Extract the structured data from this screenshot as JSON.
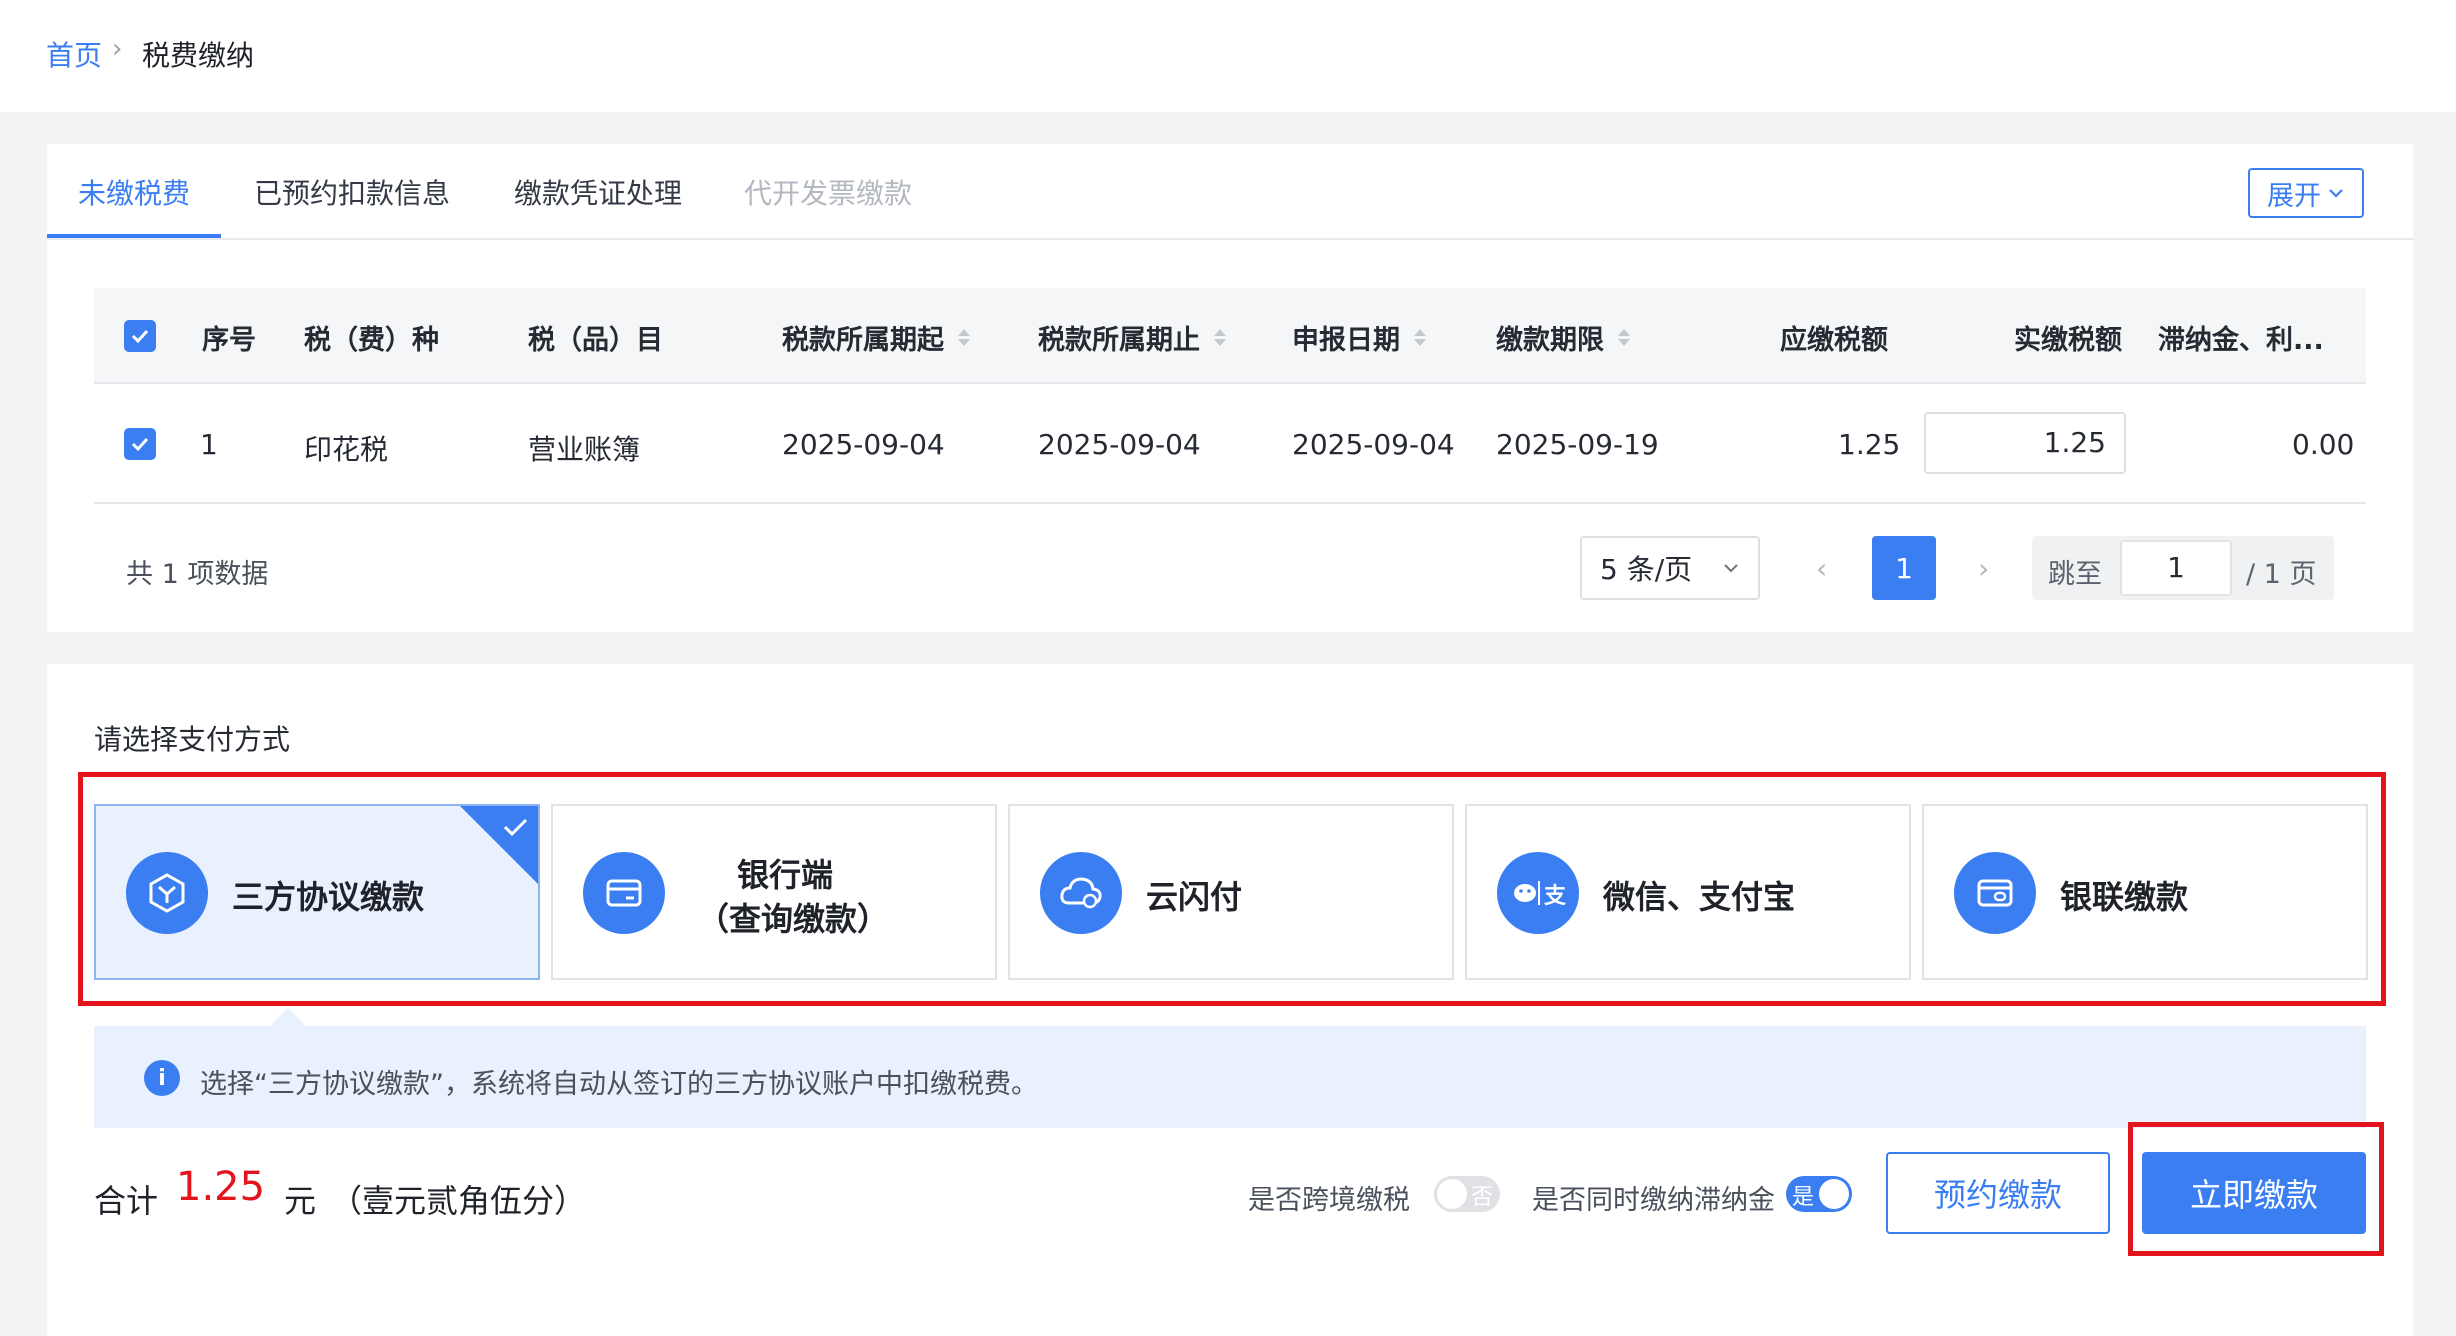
{
  "breadcrumb": {
    "home": "首页",
    "separator": "›",
    "current": "税费缴纳"
  },
  "tabs": [
    {
      "label": "未缴税费",
      "state": "active"
    },
    {
      "label": "已预约扣款信息",
      "state": "normal"
    },
    {
      "label": "缴款凭证处理",
      "state": "normal"
    },
    {
      "label": "代开发票缴款",
      "state": "disabled"
    }
  ],
  "expand_button": {
    "label": "展开",
    "icon": "chevron-down-icon"
  },
  "table": {
    "headers": {
      "seq": "序号",
      "tax_type": "税（费）种",
      "tax_item": "税（品）目",
      "period_start": "税款所属期起",
      "period_end": "税款所属期止",
      "declare_date": "申报日期",
      "pay_deadline": "缴款期限",
      "payable": "应缴税额",
      "actual": "实缴税额",
      "late_fee": "滞纳金、利..."
    },
    "rows": [
      {
        "seq": "1",
        "tax_type": "印花税",
        "tax_item": "营业账簿",
        "period_start": "2025-09-04",
        "period_end": "2025-09-04",
        "declare_date": "2025-09-04",
        "pay_deadline": "2025-09-19",
        "payable": "1.25",
        "actual": "1.25",
        "late_fee": "0.00",
        "checked": true
      }
    ]
  },
  "pagination": {
    "total_text": "共 1 项数据",
    "page_size": "5 条/页",
    "prev": "‹",
    "next": "›",
    "current_page": "1",
    "jump_label": "跳至",
    "jump_value": "1",
    "total_pages_text": "/ 1 页"
  },
  "payment": {
    "title": "请选择支付方式",
    "options": [
      {
        "label": "三方协议缴款",
        "icon": "hexagon-icon",
        "selected": true
      },
      {
        "label_line1": "银行端",
        "label_line2": "（查询缴款）",
        "icon": "card-icon",
        "selected": false
      },
      {
        "label": "云闪付",
        "icon": "cloud-icon",
        "selected": false
      },
      {
        "label": "微信、支付宝",
        "icon": "wechat-alipay-icon",
        "selected": false
      },
      {
        "label": "银联缴款",
        "icon": "unionpay-icon",
        "selected": false
      }
    ],
    "info_text": "选择“三方协议缴款”，系统将自动从签订的三方协议账户中扣缴税费。"
  },
  "summary": {
    "label": "合计",
    "amount": "1.25",
    "unit": "元",
    "amount_cn": "（壹元贰角伍分）"
  },
  "options": {
    "cross_border_label": "是否跨境缴税",
    "cross_border_value": "否",
    "late_fee_label": "是否同时缴纳滞纳金",
    "late_fee_value": "是"
  },
  "buttons": {
    "schedule": "预约缴款",
    "pay_now": "立即缴款"
  },
  "colors": {
    "primary": "#3a7ef2",
    "highlight_red": "#e3141b",
    "amount_red": "#e3141b"
  }
}
